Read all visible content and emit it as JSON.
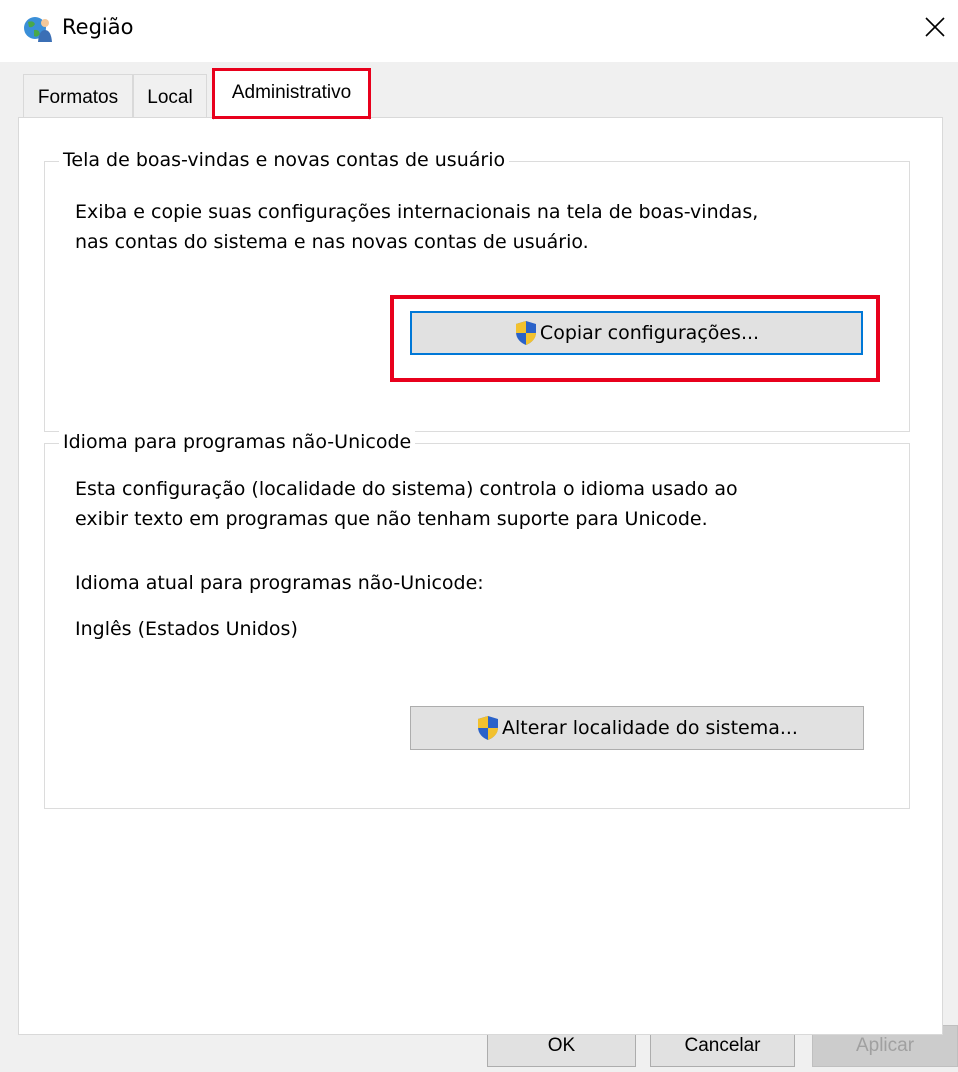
{
  "window": {
    "title": "Região",
    "icons": {
      "title": "globe-user-icon",
      "close": "close-icon",
      "shield": "uac-shield-icon"
    }
  },
  "tabs": [
    {
      "label": "Formatos",
      "selected": false
    },
    {
      "label": "Local",
      "selected": false
    },
    {
      "label": "Administrativo",
      "selected": true
    }
  ],
  "welcome_group": {
    "label": "Tela de boas-vindas e novas contas de usuário",
    "description_line1": "Exiba e copie suas configurações internacionais na tela de boas-vindas,",
    "description_line2": "nas contas do sistema e nas novas contas de usuário.",
    "copy_button_label": "Copiar configurações..."
  },
  "unicode_group": {
    "label": "Idioma para programas não-Unicode",
    "description_line1": "Esta configuração (localidade do sistema) controla o idioma usado ao",
    "description_line2": "exibir texto em programas que não tenham suporte para Unicode.",
    "current_language_label": "Idioma atual para programas não-Unicode:",
    "current_language_value": "Inglês (Estados Unidos)",
    "change_button_label": "Alterar localidade do sistema..."
  },
  "footer": {
    "ok_label": "OK",
    "cancel_label": "Cancelar",
    "apply_label": "Aplicar",
    "apply_enabled": false
  },
  "colors": {
    "highlight": "#e8001c",
    "focus_border": "#0078d7",
    "button_face": "#e1e1e1"
  }
}
